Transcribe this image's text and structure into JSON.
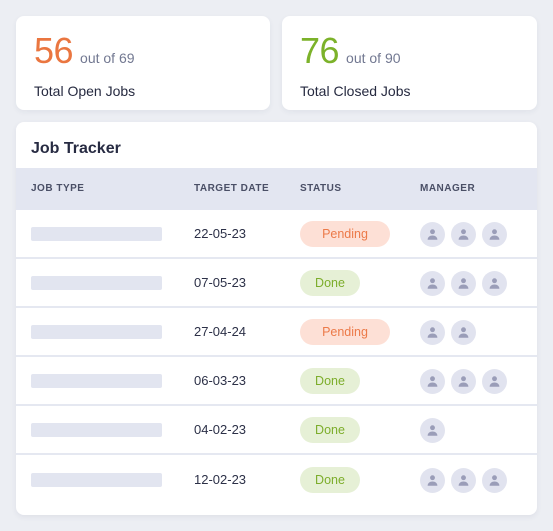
{
  "stats": {
    "open": {
      "value": "56",
      "out_of": "out of 69",
      "label": "Total Open Jobs",
      "color": "#ea7640"
    },
    "closed": {
      "value": "76",
      "out_of": "out of 90",
      "label": "Total Closed Jobs",
      "color": "#7cb22a"
    }
  },
  "tracker": {
    "title": "Job Tracker",
    "columns": [
      "JOB TYPE",
      "TARGET DATE",
      "STATUS",
      "MANAGER"
    ],
    "rows": [
      {
        "date": "22-05-23",
        "status": "Pending",
        "status_kind": "pending",
        "managers": 3
      },
      {
        "date": "07-05-23",
        "status": "Done",
        "status_kind": "done",
        "managers": 3
      },
      {
        "date": "27-04-24",
        "status": "Pending",
        "status_kind": "pending",
        "managers": 2
      },
      {
        "date": "06-03-23",
        "status": "Done",
        "status_kind": "done",
        "managers": 3
      },
      {
        "date": "04-02-23",
        "status": "Done",
        "status_kind": "done",
        "managers": 1
      },
      {
        "date": "12-02-23",
        "status": "Done",
        "status_kind": "done",
        "managers": 3
      }
    ]
  },
  "icons": {
    "manager_avatar": "user-avatar-icon"
  }
}
